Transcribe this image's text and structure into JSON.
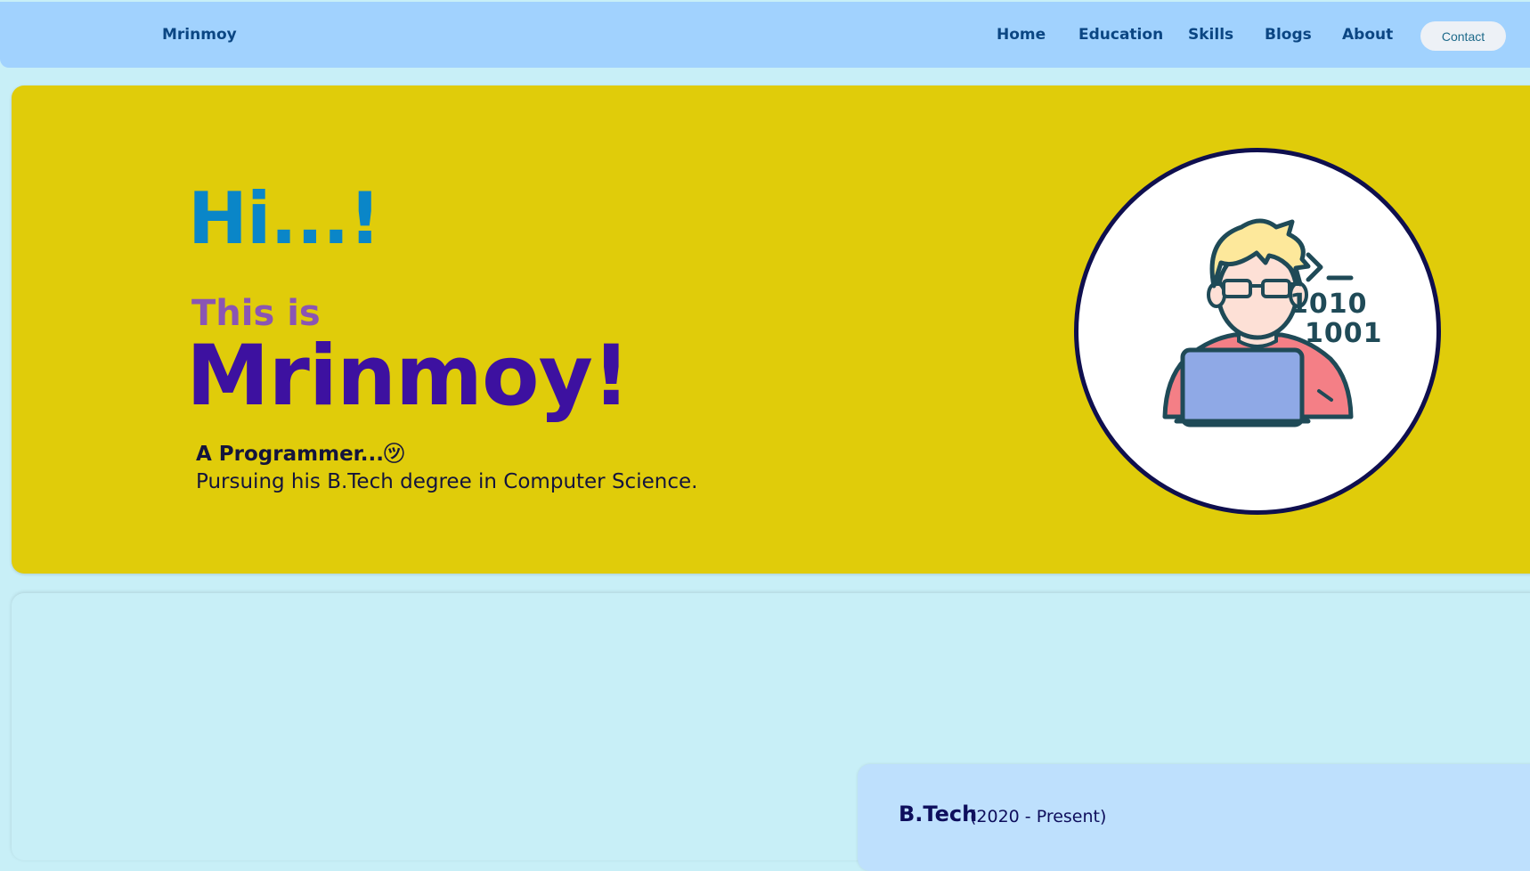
{
  "nav": {
    "brand": "Mrinmoy",
    "links": [
      "Home",
      "Education",
      "Skills",
      "Blogs",
      "About"
    ],
    "contact": "Contact"
  },
  "hero": {
    "greeting": "Hi...!",
    "this_is": "This is",
    "name": "Mrinmoy!",
    "role": "A Programmer...㋡",
    "description": "Pursuing his B.Tech degree in Computer Science.",
    "avatar_text_top": "1010",
    "avatar_text_bottom": "1001"
  },
  "education": {
    "degree": "B.Tech",
    "years": "(2020 - Present)"
  },
  "colors": {
    "nav_bg": "#a1d2fe",
    "nav_text": "#0b4683",
    "hero_bg": "#e0cc0a",
    "greeting": "#0a86c8",
    "this_is": "#8a55b4",
    "name": "#3d11a0",
    "page_bg": "#c8eff7",
    "card_bg": "#bee0fd"
  },
  "icons": {
    "avatar": "programmer-with-laptop-icon"
  }
}
